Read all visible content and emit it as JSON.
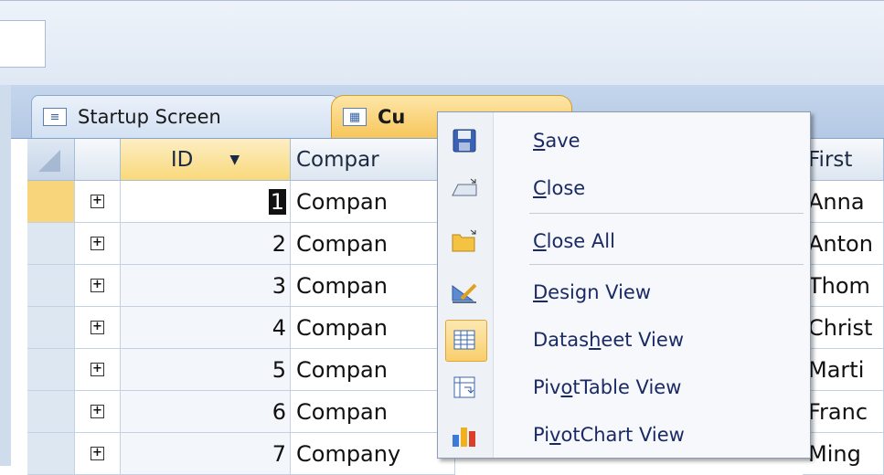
{
  "tabs": [
    {
      "label": "Startup Screen",
      "icon": "form-icon"
    },
    {
      "label": "Cu",
      "icon": "datasheet-icon"
    }
  ],
  "columns": {
    "id": "ID",
    "company": "Compar",
    "first": "First"
  },
  "rows": [
    {
      "id": "1",
      "company": "Compan",
      "first": "Anna"
    },
    {
      "id": "2",
      "company": "Compan",
      "first": "Anton"
    },
    {
      "id": "3",
      "company": "Compan",
      "first": "Thom"
    },
    {
      "id": "4",
      "company": "Compan",
      "first": "Christ"
    },
    {
      "id": "5",
      "company": "Compan",
      "first": "Marti"
    },
    {
      "id": "6",
      "company": "Compan",
      "first": "Franc"
    },
    {
      "id": "7",
      "company": "Company",
      "first": "Ming"
    }
  ],
  "context_menu": {
    "items": [
      {
        "label": "Save",
        "underline": "S",
        "rest": "ave",
        "icon": "save-icon"
      },
      {
        "label": "Close",
        "underline": "C",
        "rest": "lose",
        "icon": "close-object-icon"
      },
      {
        "label": "Close All",
        "underline": "C",
        "rest": "lose All",
        "icon": "close-all-icon"
      },
      {
        "label": "Design View",
        "underline": "D",
        "rest": "esign View",
        "icon": "design-view-icon"
      },
      {
        "label": "Datasheet View",
        "pre": "Datas",
        "underline": "h",
        "rest": "eet View",
        "icon": "datasheet-view-icon"
      },
      {
        "label": "PivotTable View",
        "pre": "Piv",
        "underline": "o",
        "rest": "tTable View",
        "icon": "pivottable-icon"
      },
      {
        "label": "PivotChart View",
        "pre": "Pi",
        "underline": "v",
        "rest": "otChart View",
        "icon": "pivotchart-icon"
      }
    ]
  }
}
